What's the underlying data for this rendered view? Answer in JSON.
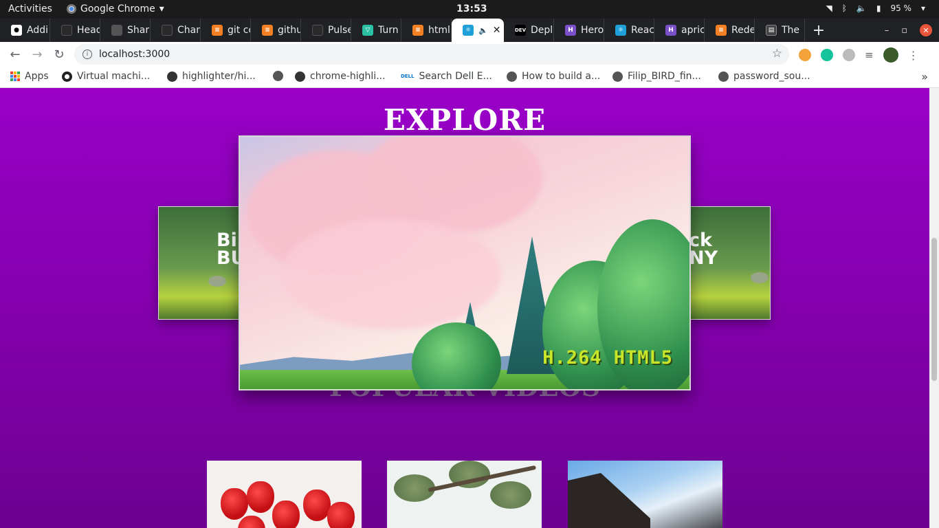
{
  "os_bar": {
    "activities": "Activities",
    "app_name": "Google Chrome",
    "clock": "13:53",
    "battery": "95 %"
  },
  "tabs": [
    {
      "label": "Addi",
      "icon": "github-icon",
      "color": "#ffffff"
    },
    {
      "label": "Head",
      "icon": "github-icon",
      "color": "#ffffff"
    },
    {
      "label": "Shar",
      "icon": "globe-icon",
      "color": "#888888"
    },
    {
      "label": "Chan",
      "icon": "github-icon",
      "color": "#ffffff"
    },
    {
      "label": "git cc",
      "icon": "stackoverflow-icon",
      "color": "#f48024"
    },
    {
      "label": "githu",
      "icon": "stackoverflow-icon",
      "color": "#f48024"
    },
    {
      "label": "Pulse",
      "icon": "github-icon",
      "color": "#ffffff"
    },
    {
      "label": "Turn",
      "icon": "turn-icon",
      "color": "#2bbfa4"
    },
    {
      "label": "html",
      "icon": "stackoverflow-icon",
      "color": "#f48024"
    },
    {
      "label": "",
      "icon": "react-icon",
      "color": "#20a0d8",
      "active": true
    },
    {
      "label": "Depl",
      "icon": "dev-icon",
      "color": "#000000"
    },
    {
      "label": "Hero",
      "icon": "heroku-icon",
      "color": "#7950c8"
    },
    {
      "label": "Reac",
      "icon": "react-icon",
      "color": "#20a0d8"
    },
    {
      "label": "apric",
      "icon": "heroku-icon",
      "color": "#7950c8"
    },
    {
      "label": "Rede",
      "icon": "stackoverflow-icon",
      "color": "#f48024"
    },
    {
      "label": "The",
      "icon": "terminal-icon",
      "color": "#444444"
    }
  ],
  "toolbar": {
    "url": "localhost:3000"
  },
  "bookmarks": [
    {
      "label": "Apps",
      "icon": "apps-grid-icon"
    },
    {
      "label": "Virtual machi...",
      "icon": "circle-icon"
    },
    {
      "label": "highlighter/hi...",
      "icon": "github-icon"
    },
    {
      "label": "",
      "icon": "globe-icon"
    },
    {
      "label": "chrome-highli...",
      "icon": "github-icon"
    },
    {
      "label": "Search Dell E...",
      "icon": "dell-icon"
    },
    {
      "label": "How to build a...",
      "icon": "globe-icon"
    },
    {
      "label": "Filip_BIRD_fin...",
      "icon": "globe-icon"
    },
    {
      "label": "password_sou...",
      "icon": "globe-icon"
    }
  ],
  "page": {
    "explore_title": "EXPLORE",
    "left_card_text": "Bi\nBU",
    "right_card_text": "ck\nNY",
    "player_caption": "H.264 HTML5",
    "popular_title": "POPULAR VIDEOS"
  },
  "colors": {
    "page_top": "#9a00c8",
    "page_bottom": "#6d0092",
    "caption": "#c8e52a"
  }
}
